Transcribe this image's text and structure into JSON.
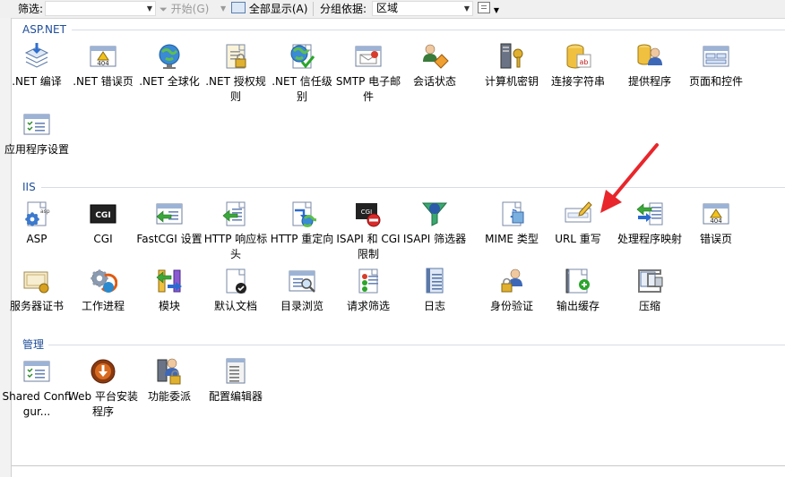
{
  "toolbar": {
    "filter_label": "筛选:",
    "filter_value": "",
    "start_label": "开始(G)",
    "show_all_label": "全部显示(A)",
    "group_by_label": "分组依据:",
    "group_by_value": "区域",
    "view_icon": "grid-view-icon"
  },
  "groups": {
    "aspnet": {
      "title": "ASP.NET",
      "items": [
        {
          "label": ".NET 编译",
          "icon": "dotnet-compile-icon"
        },
        {
          "label": ".NET 错误页",
          "icon": "error-page-404-icon"
        },
        {
          "label": ".NET 全球化",
          "icon": "globe-icon"
        },
        {
          "label": ".NET 授权规则",
          "icon": "auth-rules-icon"
        },
        {
          "label": ".NET 信任级别",
          "icon": "trust-level-icon"
        },
        {
          "label": "SMTP 电子邮件",
          "icon": "smtp-email-icon"
        },
        {
          "label": "会话状态",
          "icon": "session-state-icon"
        },
        {
          "label": "计算机密钥",
          "icon": "machine-key-icon"
        },
        {
          "label": "连接字符串",
          "icon": "connection-string-icon"
        },
        {
          "label": "提供程序",
          "icon": "providers-icon"
        },
        {
          "label": "页面和控件",
          "icon": "pages-controls-icon"
        },
        {
          "label": "应用程序设置",
          "icon": "app-settings-icon"
        }
      ]
    },
    "iis": {
      "title": "IIS",
      "items": [
        {
          "label": "ASP",
          "icon": "asp-icon"
        },
        {
          "label": "CGI",
          "icon": "cgi-icon"
        },
        {
          "label": "FastCGI 设置",
          "icon": "fastcgi-icon"
        },
        {
          "label": "HTTP 响应标头",
          "icon": "http-headers-icon"
        },
        {
          "label": "HTTP 重定向",
          "icon": "http-redirect-icon"
        },
        {
          "label": "ISAPI 和 CGI 限制",
          "icon": "isapi-cgi-restrictions-icon"
        },
        {
          "label": "ISAPI 筛选器",
          "icon": "isapi-filter-icon"
        },
        {
          "label": "MIME 类型",
          "icon": "mime-types-icon"
        },
        {
          "label": "URL 重写",
          "icon": "url-rewrite-icon"
        },
        {
          "label": "处理程序映射",
          "icon": "handler-mappings-icon"
        },
        {
          "label": "错误页",
          "icon": "error-page-404-icon"
        },
        {
          "label": "服务器证书",
          "icon": "server-certificates-icon"
        },
        {
          "label": "工作进程",
          "icon": "worker-processes-icon"
        },
        {
          "label": "模块",
          "icon": "modules-icon"
        },
        {
          "label": "默认文档",
          "icon": "default-document-icon"
        },
        {
          "label": "目录浏览",
          "icon": "directory-browsing-icon"
        },
        {
          "label": "请求筛选",
          "icon": "request-filtering-icon"
        },
        {
          "label": "日志",
          "icon": "logging-icon"
        },
        {
          "label": "身份验证",
          "icon": "authentication-icon"
        },
        {
          "label": "输出缓存",
          "icon": "output-caching-icon"
        },
        {
          "label": "压缩",
          "icon": "compression-icon"
        }
      ]
    },
    "mgmt": {
      "title": "管理",
      "items": [
        {
          "label": "Shared Configur...",
          "icon": "shared-config-icon"
        },
        {
          "label": "Web 平台安装程序",
          "icon": "web-platform-installer-icon"
        },
        {
          "label": "功能委派",
          "icon": "feature-delegation-icon"
        },
        {
          "label": "配置编辑器",
          "icon": "config-editor-icon"
        }
      ]
    }
  },
  "annotation": {
    "arrow_color": "#e8262b"
  }
}
